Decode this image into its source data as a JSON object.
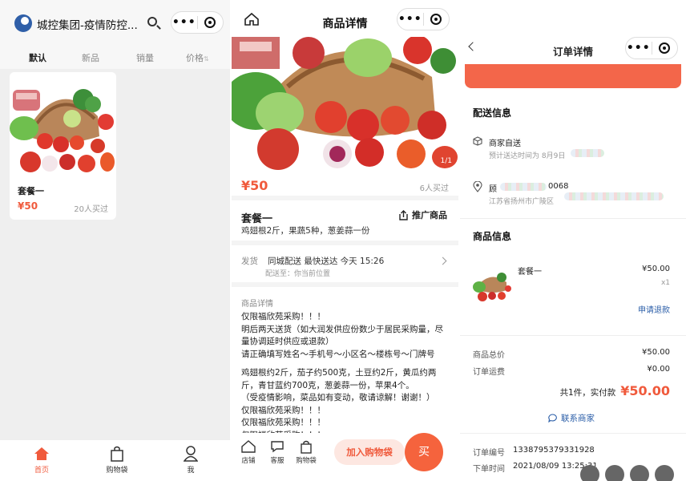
{
  "list_page": {
    "title": "城控集团-疫情防控...",
    "tabs": [
      "默认",
      "新品",
      "销量",
      "价格"
    ],
    "sort_arrow": "⇅",
    "product": {
      "name": "套餐一",
      "price": "¥50",
      "sold": "20人买过"
    },
    "tabbar": [
      {
        "label": "首页",
        "icon": "home-icon"
      },
      {
        "label": "购物袋",
        "icon": "bag-icon"
      },
      {
        "label": "我",
        "icon": "person-icon"
      }
    ]
  },
  "detail_page": {
    "title": "商品详情",
    "price": "¥50",
    "bought": "6人买过",
    "image_counter": "1/1",
    "name": "套餐一",
    "share_label": "推广商品",
    "summary": "鸡翅根2斤，果蔬5种，葱姜蒜一份",
    "shipping_label": "发货",
    "shipping_value": "同城配送  最快送达 今天 15:26",
    "delivery_to": "配送至：你当前位置",
    "detail_label": "商品详情",
    "detail_lines": [
      "仅限福欣苑采购！！！",
      "明后两天送货（如大润发供应份数少于居民采购量，尽量协调延时供应或退款）",
      "请正确填写姓名～手机号～小区名～楼栋号～门牌号",
      "",
      "鸡翅根约2斤，茄子约500克，土豆约2斤，黄瓜约两斤，青甘蓝约700克，葱姜蒜一份，苹果4个。",
      "（受疫情影响，菜品如有变动，敬请谅解！谢谢！）",
      "仅限福欣苑采购！！！",
      "仅限福欣苑采购！！！",
      "仅限福欣苑采购！！！"
    ],
    "bottom": {
      "store": "店铺",
      "service": "客服",
      "bag": "购物袋",
      "add_cart": "加入购物袋",
      "buy": "买"
    }
  },
  "order_page": {
    "title": "订单详情",
    "delivery_section": "配送信息",
    "merchant_delivery": "商家自送",
    "expected_time": "预计送达时间为 8月9日",
    "receiver_suffix": "0068",
    "receiver_prefix": "顾",
    "address": "江苏省扬州市广陵区",
    "goods_section": "商品信息",
    "item_name": "套餐一",
    "item_price": "¥50.00",
    "item_qty": "x1",
    "refund": "申请退款",
    "goods_total_label": "商品总价",
    "goods_total": "¥50.00",
    "freight_label": "订单运费",
    "freight": "¥0.00",
    "count_label": "共1件，实付款",
    "paid": "¥50.00",
    "contact": "联系商家",
    "order_no_label": "订单编号",
    "order_no": "1338795379331928",
    "order_time_label": "下单时间",
    "order_time": "2021/08/09 13:25:31"
  },
  "colors": {
    "accent": "#f05a3c",
    "link": "#2b5ea8"
  }
}
